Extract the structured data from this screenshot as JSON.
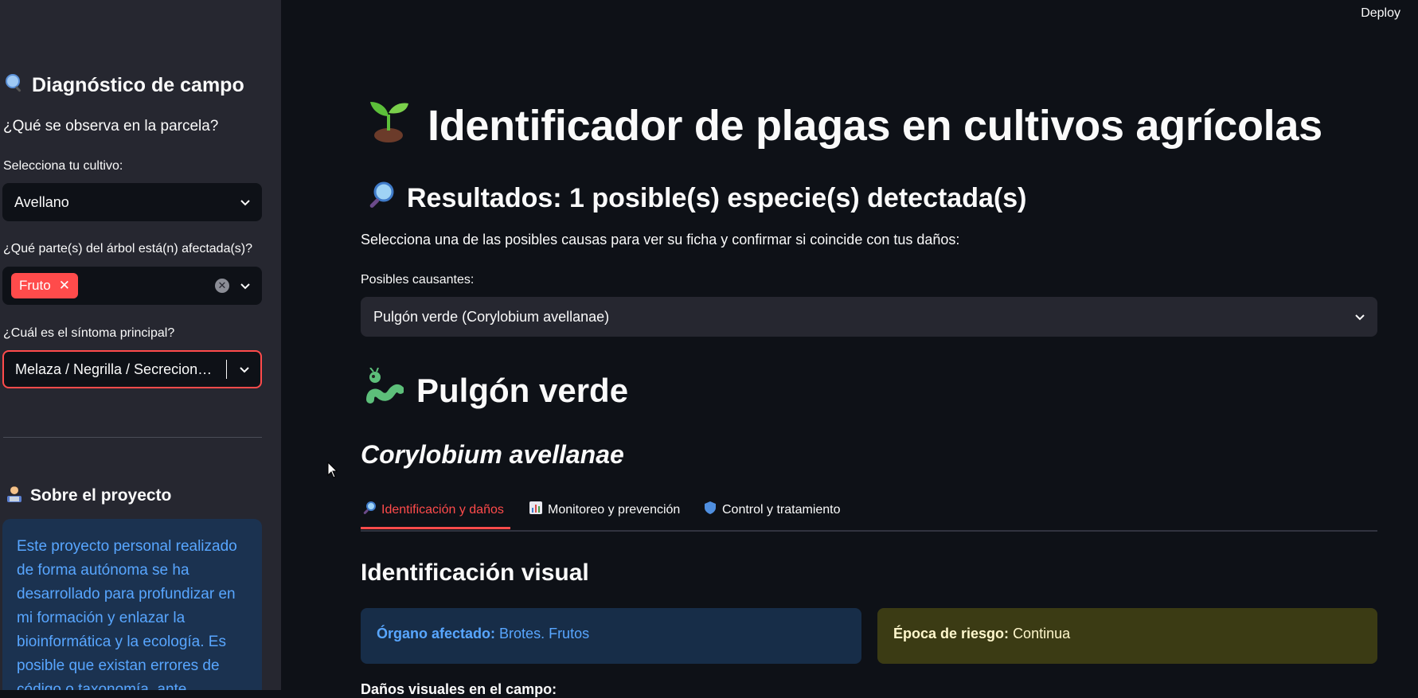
{
  "header": {
    "deploy_label": "Deploy"
  },
  "sidebar": {
    "title": "Diagnóstico de campo",
    "question": "¿Qué se observa en la parcela?",
    "crop_label": "Selecciona tu cultivo:",
    "crop_value": "Avellano",
    "parts_label": "¿Qué parte(s) del árbol está(n) afectada(s)?",
    "parts_chip": "Fruto",
    "symptom_label": "¿Cuál es el síntoma principal?",
    "symptom_value": "Melaza / Negrilla / Secrecion…",
    "about_title": "Sobre el proyecto",
    "about_text": "Este proyecto personal realizado de forma autónoma se ha desarrollado para profundizar en mi formación y enlazar la bioinformática y la ecología. Es posible que existan errores de código o taxonomía, ante"
  },
  "main": {
    "title": "Identificador de plagas en cultivos agrícolas",
    "results_title": "Resultados: 1 posible(s) especie(s) detectada(s)",
    "instruction": "Selecciona una de las posibles causas para ver su ficha y confirmar si coincide con tus daños:",
    "causes_label": "Posibles causantes:",
    "causes_value": "Pulgón verde (Corylobium avellanae)",
    "pest_name": "Pulgón verde",
    "scientific_name": "Corylobium avellanae",
    "tabs": [
      {
        "label": "Identificación y daños",
        "active": true
      },
      {
        "label": "Monitoreo y prevención",
        "active": false
      },
      {
        "label": "Control y tratamiento",
        "active": false
      }
    ],
    "section_title": "Identificación visual",
    "organ_label": "Órgano afectado:",
    "organ_value": "Brotes. Frutos",
    "risk_label": "Época de riesgo:",
    "risk_value": "Continua",
    "cut_text": "Daños visuales en el campo:"
  },
  "colors": {
    "accent": "#ff4b4b",
    "background": "#0e1117",
    "sidebar": "#262730",
    "info_blue": "#58a6ff",
    "warning_bg": "#3b3b14"
  }
}
